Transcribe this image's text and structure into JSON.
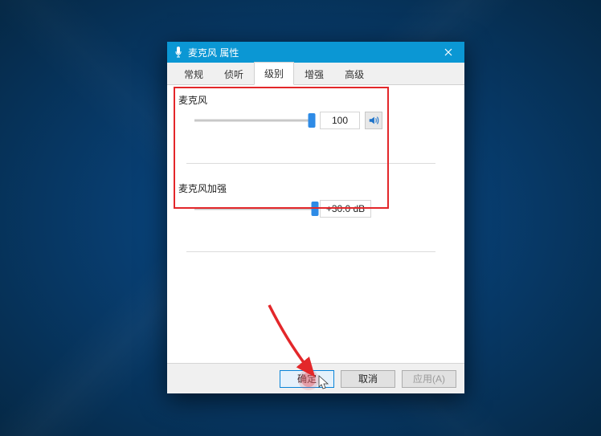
{
  "window": {
    "title": "麦克风 属性"
  },
  "tabs": [
    {
      "label": "常规",
      "active": false
    },
    {
      "label": "侦听",
      "active": false
    },
    {
      "label": "级别",
      "active": true
    },
    {
      "label": "增强",
      "active": false
    },
    {
      "label": "高级",
      "active": false
    }
  ],
  "levels": {
    "mic": {
      "label": "麦克风",
      "value": "100",
      "slider_percent": 100
    },
    "boost": {
      "label": "麦克风加强",
      "value": "+30.0 dB",
      "slider_percent": 100
    }
  },
  "buttons": {
    "ok": "确定",
    "cancel": "取消",
    "apply": "应用(A)"
  },
  "colors": {
    "titlebar": "#0b97d4",
    "accent": "#2e8be6",
    "highlight": "#e3272a"
  }
}
